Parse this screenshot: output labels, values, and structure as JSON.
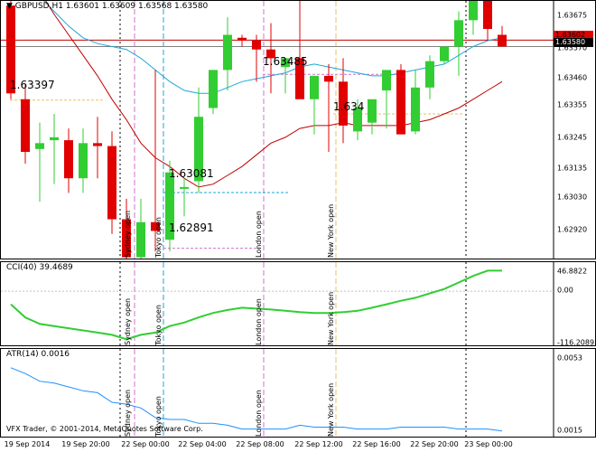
{
  "main": {
    "header": "GBPUSD,H1  1.63601 1.63609 1.63568 1.63580",
    "price_labels": [
      "1.63675",
      "1.63570",
      "1.63460",
      "1.63355",
      "1.63245",
      "1.63135",
      "1.63030",
      "1.62920"
    ],
    "tag_red": "1.63602",
    "tag_black": "1.63580",
    "level_labels": [
      "1.63397",
      "1.63485",
      "1.63081",
      "1.62891",
      "1.634"
    ]
  },
  "cci": {
    "header": "CCI(40) 39.4689",
    "labels": [
      "46.8822",
      "0.00",
      "-116.2089"
    ]
  },
  "atr": {
    "header": "ATR(14) 0.0016",
    "labels": [
      "0.0053",
      "0.0015"
    ]
  },
  "copyright": "VFX Trader, © 2001-2014, MetaQuotes Software Corp.",
  "sessions": [
    "Sydney open",
    "Tokyo open",
    "London open",
    "New York open"
  ],
  "time_labels": [
    "19 Sep 2014",
    "19 Sep 20:00",
    "22 Sep 00:00",
    "22 Sep 04:00",
    "22 Sep 08:00",
    "22 Sep 12:00",
    "22 Sep 16:00",
    "22 Sep 20:00",
    "23 Sep 00:00"
  ],
  "colors": {
    "bull": "#32cd32",
    "bear": "#e00000",
    "ma_red": "#c00000",
    "ma_blue": "#1ba7d8",
    "cci": "#32cd32",
    "atr": "#1e90ff"
  },
  "chart_data": {
    "type": "candlestick",
    "symbol": "GBPUSD",
    "timeframe": "H1",
    "ohlc": [
      [
        1.6372,
        1.6378,
        1.634,
        1.6342
      ],
      [
        1.634,
        1.6345,
        1.6318,
        1.6322
      ],
      [
        1.6323,
        1.6332,
        1.6305,
        1.6325
      ],
      [
        1.6326,
        1.6335,
        1.6311,
        1.6327
      ],
      [
        1.6326,
        1.633,
        1.6308,
        1.6313
      ],
      [
        1.6313,
        1.633,
        1.6308,
        1.6325
      ],
      [
        1.6325,
        1.6334,
        1.6313,
        1.6324
      ],
      [
        1.6324,
        1.6329,
        1.6294,
        1.6299
      ],
      [
        1.6299,
        1.6306,
        1.6284,
        1.6286
      ],
      [
        1.6286,
        1.6306,
        1.6281,
        1.6298
      ],
      [
        1.6298,
        1.635,
        1.6288,
        1.6295
      ],
      [
        1.6292,
        1.6319,
        1.6288,
        1.6315
      ],
      [
        1.631,
        1.6313,
        1.63,
        1.631
      ],
      [
        1.6312,
        1.6344,
        1.6308,
        1.6334
      ],
      [
        1.6337,
        1.635,
        1.6335,
        1.635
      ],
      [
        1.635,
        1.6368,
        1.6343,
        1.6362
      ],
      [
        1.6361,
        1.6362,
        1.6358,
        1.636
      ],
      [
        1.636,
        1.6362,
        1.6346,
        1.6357
      ],
      [
        1.6357,
        1.6366,
        1.6342,
        1.6354
      ],
      [
        1.6351,
        1.6354,
        1.6342,
        1.6354
      ],
      [
        1.6354,
        1.6388,
        1.6349,
        1.634
      ],
      [
        1.634,
        1.6345,
        1.6328,
        1.6348
      ],
      [
        1.6348,
        1.6352,
        1.6322,
        1.6346
      ],
      [
        1.6346,
        1.6354,
        1.6325,
        1.6331
      ],
      [
        1.6329,
        1.634,
        1.6326,
        1.6337
      ],
      [
        1.6332,
        1.6339,
        1.6328,
        1.634
      ],
      [
        1.6343,
        1.6346,
        1.633,
        1.635
      ],
      [
        1.635,
        1.6352,
        1.6328,
        1.6328
      ],
      [
        1.6329,
        1.635,
        1.6328,
        1.6344
      ],
      [
        1.6344,
        1.6355,
        1.634,
        1.6353
      ],
      [
        1.6353,
        1.6355,
        1.6352,
        1.6358
      ],
      [
        1.6358,
        1.637,
        1.6348,
        1.6367
      ],
      [
        1.6367,
        1.6372,
        1.6362,
        1.6376
      ],
      [
        1.6376,
        1.6373,
        1.636,
        1.6364
      ],
      [
        1.6362,
        1.6365,
        1.6358,
        1.6358
      ]
    ],
    "ma_red": [
      1.6393,
      1.6385,
      1.6377,
      1.6369,
      1.6362,
      1.6355,
      1.6348,
      1.634,
      1.6333,
      1.6325,
      1.632,
      1.6317,
      1.6313,
      1.631,
      1.6311,
      1.6314,
      1.6317,
      1.6321,
      1.6325,
      1.6327,
      1.633,
      1.6331,
      1.6331,
      1.6332,
      1.6331,
      1.6331,
      1.6331,
      1.6331,
      1.6332,
      1.6333,
      1.6335,
      1.6337,
      1.634,
      1.6343,
      1.6346
    ],
    "ma_blue": [
      1.6383,
      1.638,
      1.6375,
      1.637,
      1.6365,
      1.6361,
      1.6359,
      1.6358,
      1.6357,
      1.6354,
      1.635,
      1.6346,
      1.6343,
      1.6342,
      1.6342,
      1.6344,
      1.6346,
      1.6347,
      1.6348,
      1.6349,
      1.6351,
      1.6352,
      1.6351,
      1.635,
      1.6349,
      1.6348,
      1.6348,
      1.6349,
      1.635,
      1.6351,
      1.6352,
      1.6355,
      1.6358,
      1.636,
      1.6361
    ],
    "price_range": [
      1.62865,
      1.63705
    ],
    "cci": [
      -30,
      -60,
      -75,
      -80,
      -85,
      -90,
      -95,
      -100,
      -110,
      -100,
      -95,
      -80,
      -72,
      -60,
      -50,
      -43,
      -38,
      -40,
      -42,
      -45,
      -48,
      -50,
      -50,
      -48,
      -45,
      -38,
      -30,
      -22,
      -15,
      -5,
      5,
      20,
      35,
      47,
      47
    ],
    "cci_range": [
      -120,
      50
    ],
    "atr": [
      0.0048,
      0.0045,
      0.0041,
      0.004,
      0.0038,
      0.0036,
      0.0035,
      0.003,
      0.0029,
      0.0027,
      0.0022,
      0.0021,
      0.0021,
      0.0019,
      0.0019,
      0.0018,
      0.0016,
      0.0016,
      0.0016,
      0.0016,
      0.0018,
      0.0017,
      0.0017,
      0.0017,
      0.0016,
      0.0016,
      0.0016,
      0.0017,
      0.0017,
      0.0017,
      0.0017,
      0.0016,
      0.0016,
      0.0016,
      0.0015
    ],
    "atr_range": [
      0.0013,
      0.0055
    ]
  }
}
